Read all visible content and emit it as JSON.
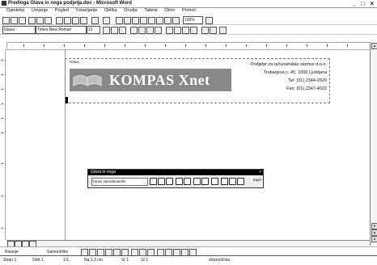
{
  "window": {
    "title": "Predloga Glava in noga podjetja.doc - Microsoft Word",
    "controls": "_ □ ×"
  },
  "menu": [
    "Datoteka",
    "Urejanje",
    "Pogled",
    "Vstavljanje",
    "Oblika",
    "Orodja",
    "Tabela",
    "Okno",
    "Pomoč"
  ],
  "toolbar": {
    "zoom": "100%",
    "style": "Glava",
    "font": "Times New Roman",
    "size": "12"
  },
  "header": {
    "label": "Glava",
    "logo_text": "KOMPAS Xnet",
    "lines": [
      "Podjetje za računalniške storitve d.o.o.",
      "Trubarjeva c. 45, 1000 Ljubljana",
      "Tel: (01) 2344-2929",
      "Fax: (01) 2347-4022"
    ]
  },
  "header_footer_toolbar": {
    "title": "Glava in noga",
    "insert_autotext": "Vstavi samobesedilo",
    "close": "Zapri"
  },
  "drawing": {
    "draw": "Risanje",
    "autoshapes": "Samooblike"
  },
  "status": {
    "page": "Stran 1",
    "section": "Odd 1",
    "pages": "1/1",
    "position": "Na 1,3 cm",
    "line": "Vr 1",
    "column": "St 1",
    "language": "slovenščina"
  }
}
